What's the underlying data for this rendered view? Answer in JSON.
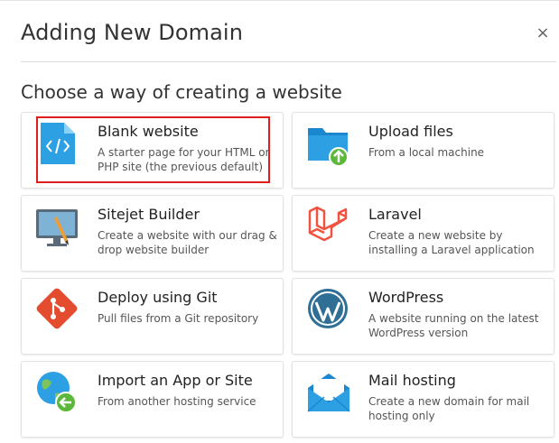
{
  "dialog": {
    "title": "Adding New Domain",
    "close_symbol": "×",
    "subtitle": "Choose a way of creating a website"
  },
  "options": [
    {
      "title": "Blank website",
      "description": "A starter page for your HTML or PHP site (the previous default)",
      "icon": "code-file-icon",
      "highlighted": true
    },
    {
      "title": "Upload files",
      "description": "From a local machine",
      "icon": "upload-folder-icon"
    },
    {
      "title": "Sitejet Builder",
      "description": "Create a website with our drag & drop website builder",
      "icon": "sitejet-builder-icon"
    },
    {
      "title": "Laravel",
      "description": "Create a new website by installing a Laravel application",
      "icon": "laravel-icon"
    },
    {
      "title": "Deploy using Git",
      "description": "Pull files from a Git repository",
      "icon": "git-icon"
    },
    {
      "title": "WordPress",
      "description": "A website running on the latest WordPress version",
      "icon": "wordpress-icon"
    },
    {
      "title": "Import an App or Site",
      "description": "From another hosting service",
      "icon": "import-globe-icon"
    },
    {
      "title": "Mail hosting",
      "description": "Create a new domain for mail hosting only",
      "icon": "mail-envelope-icon"
    }
  ],
  "colors": {
    "highlight": "#e01e1e",
    "blue": "#2d9fe3",
    "green": "#5bb83a",
    "laravel_red": "#f05340",
    "git_red": "#e44c30",
    "wordpress_blue": "#2f6f95"
  }
}
